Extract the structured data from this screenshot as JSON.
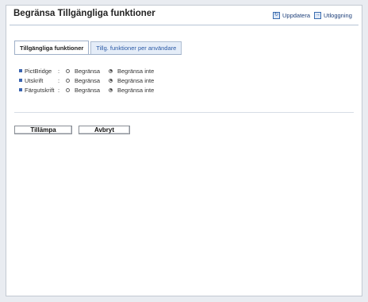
{
  "header": {
    "title": "Begränsa Tillgängliga funktioner",
    "refresh_label": "Uppdatera",
    "logout_label": "Utloggning"
  },
  "tabs": [
    {
      "label": "Tillgängliga funktioner",
      "active": true
    },
    {
      "label": "Tillg. funktioner per användare",
      "active": false
    }
  ],
  "restrictions": [
    {
      "label": "PictBridge",
      "option_restrict": "Begränsa",
      "option_no_restrict": "Begränsa inte",
      "selected": "no_restrict"
    },
    {
      "label": "Utskrift",
      "option_restrict": "Begränsa",
      "option_no_restrict": "Begränsa inte",
      "selected": "no_restrict"
    },
    {
      "label": "Färgutskrift",
      "option_restrict": "Begränsa",
      "option_no_restrict": "Begränsa inte",
      "selected": "no_restrict"
    }
  ],
  "actions": {
    "apply_label": "Tillämpa",
    "cancel_label": "Avbryt"
  },
  "colors": {
    "accent": "#3a64b0",
    "link": "#1d3f7a",
    "background": "#e9ecf1"
  },
  "icons": {
    "refresh": "refresh-icon",
    "logout": "logout-icon"
  }
}
